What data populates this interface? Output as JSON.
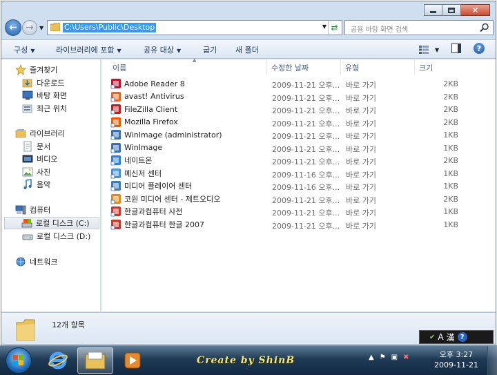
{
  "window": {
    "caption": {
      "minimize": "minimize",
      "maximize": "maximize",
      "close": "close"
    }
  },
  "address": {
    "path": "C:\\Users\\Public\\Desktop",
    "search_placeholder": "공용 바탕 화면 검색"
  },
  "commands": {
    "organize": "구성",
    "include_library": "라이브러리에 포함",
    "share_with": "공유 대상",
    "burn": "굽기",
    "new_folder": "새 폴더"
  },
  "nav": {
    "favorites": {
      "label": "즐겨찾기",
      "items": [
        "다운로드",
        "바탕 화면",
        "최근 위치"
      ]
    },
    "libraries": {
      "label": "라이브러리",
      "items": [
        "문서",
        "비디오",
        "사진",
        "음악"
      ]
    },
    "computer": {
      "label": "컴퓨터",
      "items": [
        "로컬 디스크 (C:)",
        "로컬 디스크 (D:)"
      ]
    },
    "network": {
      "label": "네트워크"
    }
  },
  "columns": {
    "name": "이름",
    "modified": "수정한 날짜",
    "type": "유형",
    "size": "크기"
  },
  "files": [
    {
      "name": "Adobe Reader 8",
      "date": "2009-11-21 오후...",
      "type": "바로 가기",
      "size": "2KB",
      "icon": "adobe-reader-icon",
      "color": "#c8102e"
    },
    {
      "name": "avast! Antivirus",
      "date": "2009-11-21 오후...",
      "type": "바로 가기",
      "size": "2KB",
      "icon": "avast-icon",
      "color": "#e8661e"
    },
    {
      "name": "FileZilla Client",
      "date": "2009-11-21 오후...",
      "type": "바로 가기",
      "size": "2KB",
      "icon": "filezilla-icon",
      "color": "#bf1e1e"
    },
    {
      "name": "Mozilla Firefox",
      "date": "2009-11-21 오후...",
      "type": "바로 가기",
      "size": "2KB",
      "icon": "firefox-icon",
      "color": "#e66000"
    },
    {
      "name": "WinImage (administrator)",
      "date": "2009-11-21 오후...",
      "type": "바로 가기",
      "size": "1KB",
      "icon": "winimage-icon",
      "color": "#3a6fb0"
    },
    {
      "name": "WinImage",
      "date": "2009-11-21 오후...",
      "type": "바로 가기",
      "size": "1KB",
      "icon": "winimage-icon",
      "color": "#3a6fb0"
    },
    {
      "name": "네이트온",
      "date": "2009-11-21 오후...",
      "type": "바로 가기",
      "size": "2KB",
      "icon": "nateon-icon",
      "color": "#2e7fd6"
    },
    {
      "name": "메신저 센터",
      "date": "2009-11-16 오후...",
      "type": "바로 가기",
      "size": "1KB",
      "icon": "messenger-icon",
      "color": "#4a90d9"
    },
    {
      "name": "미디어 플레이어 센터",
      "date": "2009-11-16 오후...",
      "type": "바로 가기",
      "size": "1KB",
      "icon": "media-player-icon",
      "color": "#3d7ab8"
    },
    {
      "name": "코원 미디어 센터 - 제트오디오",
      "date": "2009-11-21 오후...",
      "type": "바로 가기",
      "size": "2KB",
      "icon": "jetaudio-icon",
      "color": "#e08a1e"
    },
    {
      "name": "한글과컴퓨터 사전",
      "date": "2009-11-21 오후...",
      "type": "바로 가기",
      "size": "1KB",
      "icon": "hancom-dictionary-icon",
      "color": "#d0352a"
    },
    {
      "name": "한글과컴퓨터 한글 2007",
      "date": "2009-11-21 오후...",
      "type": "바로 가기",
      "size": "1KB",
      "icon": "hwp-icon",
      "color": "#c0392b"
    }
  ],
  "details": {
    "count": "12개 항목"
  },
  "taskbar": {
    "brand": "Create by ShinB",
    "clock_time": "오후 3:27",
    "clock_date": "2009-11-21"
  },
  "ime": {
    "mode": "A",
    "hanja": "漢",
    "help": "?"
  },
  "colors": {
    "accent": "#3399ff",
    "taskbar": "#1f3a55"
  }
}
